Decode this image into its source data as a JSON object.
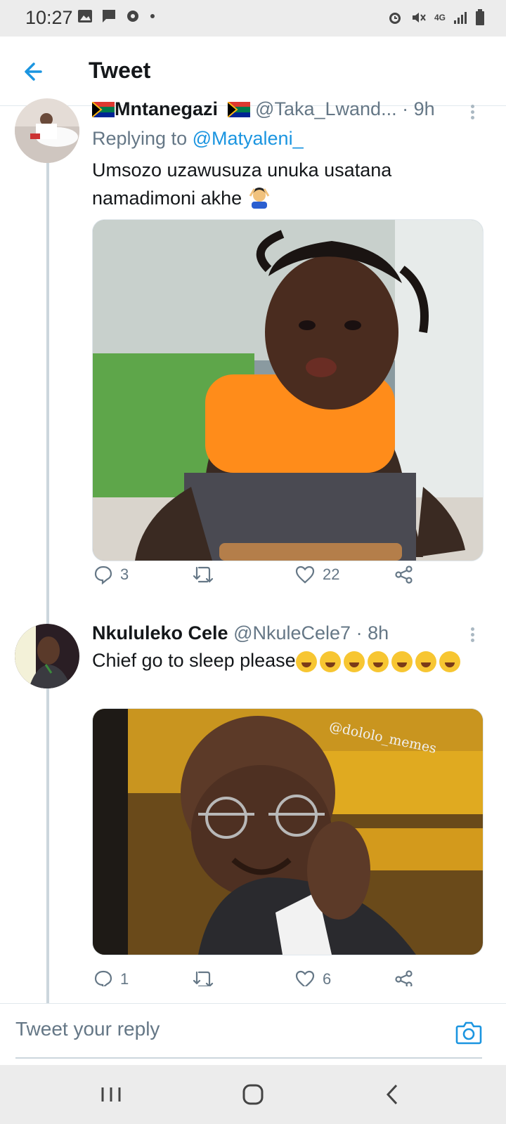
{
  "status_bar": {
    "time": "10:27",
    "left_icons": [
      "image-icon",
      "message-icon",
      "gear-icon",
      "dot-icon"
    ],
    "right_icons": [
      "alarm-icon",
      "mute-icon",
      "4g-icon",
      "signal-icon",
      "battery-icon"
    ],
    "network": "4G"
  },
  "header": {
    "title": "Tweet"
  },
  "tweets": [
    {
      "display_name": "Mntanegazi",
      "handle": "@Taka_Lwand...",
      "time": "· 9h",
      "replying_prefix": "Replying to",
      "replying_to": "@Matyaleni_",
      "text": "Umsozo uzawusuza unuka usatana namadimoni akhe",
      "replies": "3",
      "retweets": "",
      "likes": "22"
    },
    {
      "display_name": "Nkululeko Cele",
      "handle": "@NkuleCele7",
      "time": "· 8h",
      "text": "Chief go to sleep please",
      "media_watermark": "@dololo_memes",
      "replies": "1",
      "retweets": "",
      "likes": "6"
    }
  ],
  "reply_box": {
    "placeholder": "Tweet your reply"
  },
  "colors": {
    "accent": "#1b95e0",
    "muted": "#657786",
    "status_bg": "#ececec"
  }
}
